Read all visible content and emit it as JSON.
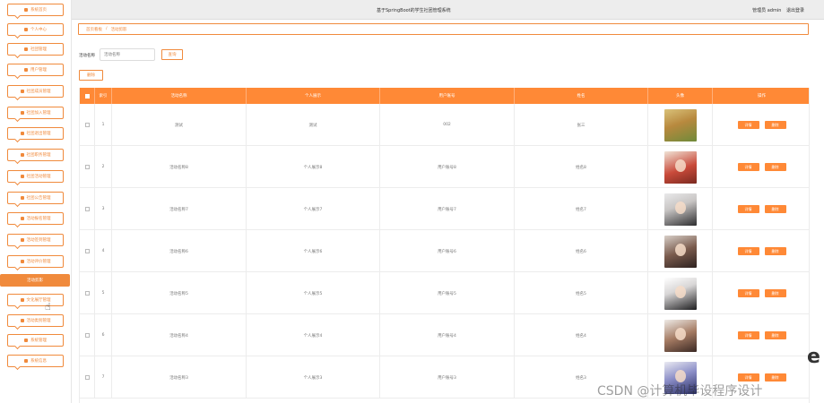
{
  "app": {
    "title": "基于SpringBoot的学生社团管理系统",
    "user_info": "管理员 admin",
    "logout": "退出登录"
  },
  "sidebar": {
    "items": [
      {
        "label": "系统首页",
        "icon": "home-icon"
      },
      {
        "label": "个人中心",
        "icon": "user-icon"
      },
      {
        "label": "社团管理",
        "icon": "group-icon"
      },
      {
        "label": "用户管理",
        "icon": "users-icon"
      },
      {
        "label": "社团成员管理",
        "icon": "list-icon"
      },
      {
        "label": "社团加入管理",
        "icon": "join-icon"
      },
      {
        "label": "社团退出管理",
        "icon": "exit-icon"
      },
      {
        "label": "社团职务管理",
        "icon": "badge-icon"
      },
      {
        "label": "社团活动管理",
        "icon": "flag-icon"
      },
      {
        "label": "社团公告管理",
        "icon": "grid-icon"
      },
      {
        "label": "活动报名管理",
        "icon": "calendar-icon"
      },
      {
        "label": "活动签到管理",
        "icon": "check-icon"
      },
      {
        "label": "活动评价管理",
        "icon": "star-icon"
      },
      {
        "label": "活动剪影",
        "icon": "photo-icon",
        "active": true
      },
      {
        "label": "文化展厅管理",
        "icon": "hall-icon"
      },
      {
        "label": "活动类别管理",
        "icon": "category-icon"
      },
      {
        "label": "系统管理",
        "icon": "settings-icon"
      },
      {
        "label": "系统信息",
        "icon": "info-icon"
      }
    ]
  },
  "breadcrumb": {
    "home": "首页看板",
    "separator": "/",
    "current": "活动剪影"
  },
  "search": {
    "label": "活动名称",
    "placeholder": "活动名称",
    "query_button": "查询"
  },
  "actions": {
    "delete_button": "删除"
  },
  "table": {
    "columns": [
      "索引",
      "活动名称",
      "个人展示",
      "用户账号",
      "姓名",
      "头像",
      "操作"
    ],
    "rows": [
      {
        "index": "1",
        "name": "测试",
        "display": "测试",
        "account": "002",
        "realname": "张三",
        "avatar": "rabbit-photo"
      },
      {
        "index": "2",
        "name": "活动名称8",
        "display": "个人展示8",
        "account": "用户账号8",
        "realname": "姓名8",
        "avatar": "portrait-photo"
      },
      {
        "index": "3",
        "name": "活动名称7",
        "display": "个人展示7",
        "account": "用户账号7",
        "realname": "姓名7",
        "avatar": "portrait-photo"
      },
      {
        "index": "4",
        "name": "活动名称6",
        "display": "个人展示6",
        "account": "用户账号6",
        "realname": "姓名6",
        "avatar": "portrait-photo"
      },
      {
        "index": "5",
        "name": "活动名称5",
        "display": "个人展示5",
        "account": "用户账号5",
        "realname": "姓名5",
        "avatar": "portrait-photo"
      },
      {
        "index": "6",
        "name": "活动名称4",
        "display": "个人展示4",
        "account": "用户账号4",
        "realname": "姓名4",
        "avatar": "portrait-photo"
      },
      {
        "index": "7",
        "name": "活动名称3",
        "display": "个人展示3",
        "account": "用户账号3",
        "realname": "姓名3",
        "avatar": "portrait-photo"
      }
    ],
    "detail_button": "详情",
    "delete_button": "删除"
  },
  "colors": {
    "accent": "#f08a3c",
    "header": "#ff8936"
  },
  "watermark": "CSDN @计算机毕设程序设计"
}
